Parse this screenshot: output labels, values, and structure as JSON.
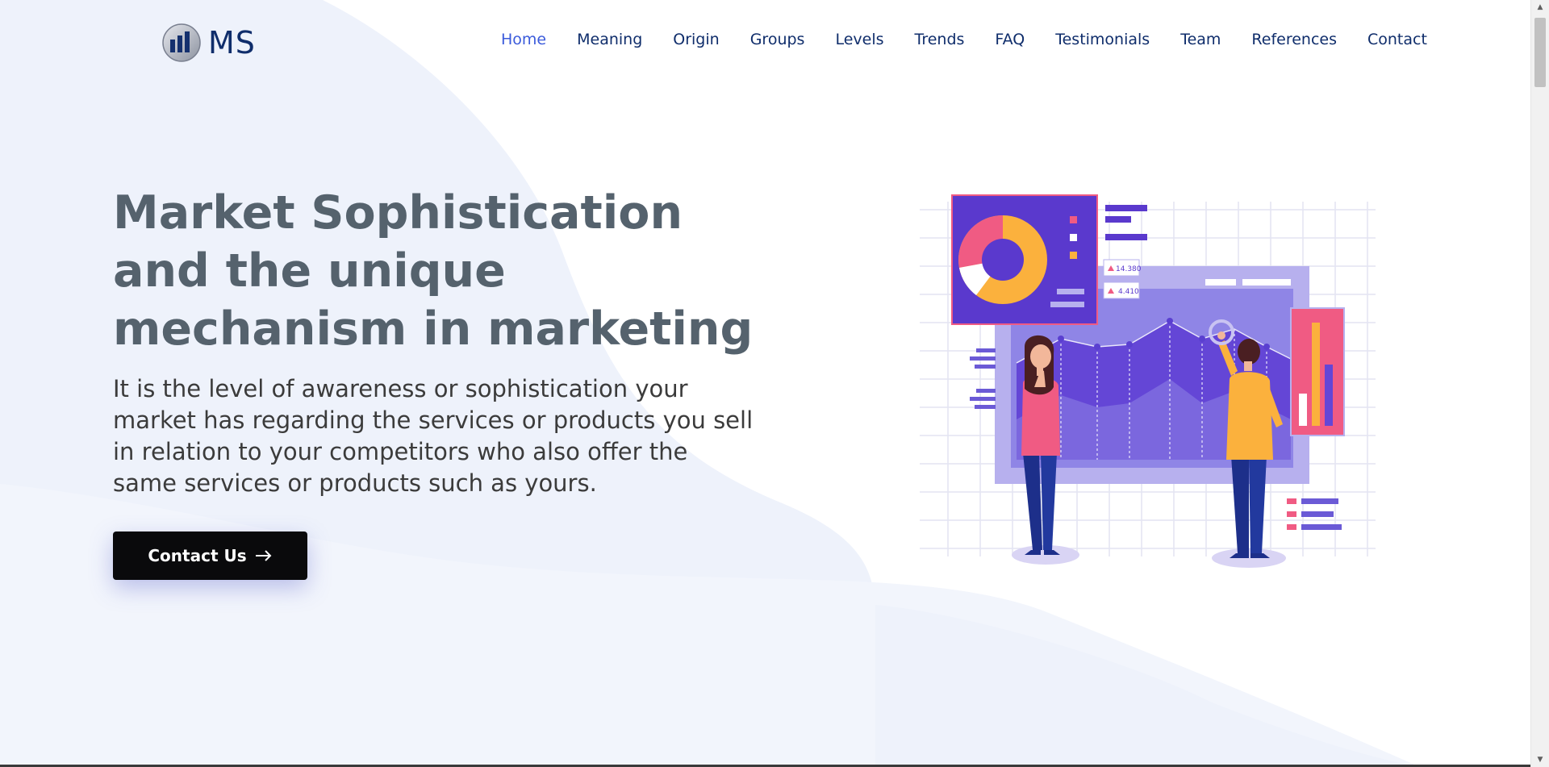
{
  "brand": {
    "name": "MS"
  },
  "nav": {
    "items": [
      {
        "label": "Home",
        "active": true
      },
      {
        "label": "Meaning"
      },
      {
        "label": "Origin"
      },
      {
        "label": "Groups"
      },
      {
        "label": "Levels"
      },
      {
        "label": "Trends"
      },
      {
        "label": "FAQ"
      },
      {
        "label": "Testimonials"
      },
      {
        "label": "Team"
      },
      {
        "label": "References"
      },
      {
        "label": "Contact"
      }
    ]
  },
  "hero": {
    "title": "Market Sophistication and the unique mechanism in marketing",
    "text": "It is the level of awareness or sophistication your market has regarding the services or products you sell in relation to your competitors who also offer the same services or products such as yours.",
    "cta_label": "Contact Us",
    "cta_icon": "arrow-right-icon"
  },
  "illustration": {
    "stat_1": "14.380",
    "stat_2": "4.410"
  },
  "colors": {
    "nav_text": "#0f2d6b",
    "nav_active": "#3b5bdb",
    "title": "#55626d",
    "cta_bg": "#0a0a0c",
    "bg_wave": "#eef2fb"
  }
}
